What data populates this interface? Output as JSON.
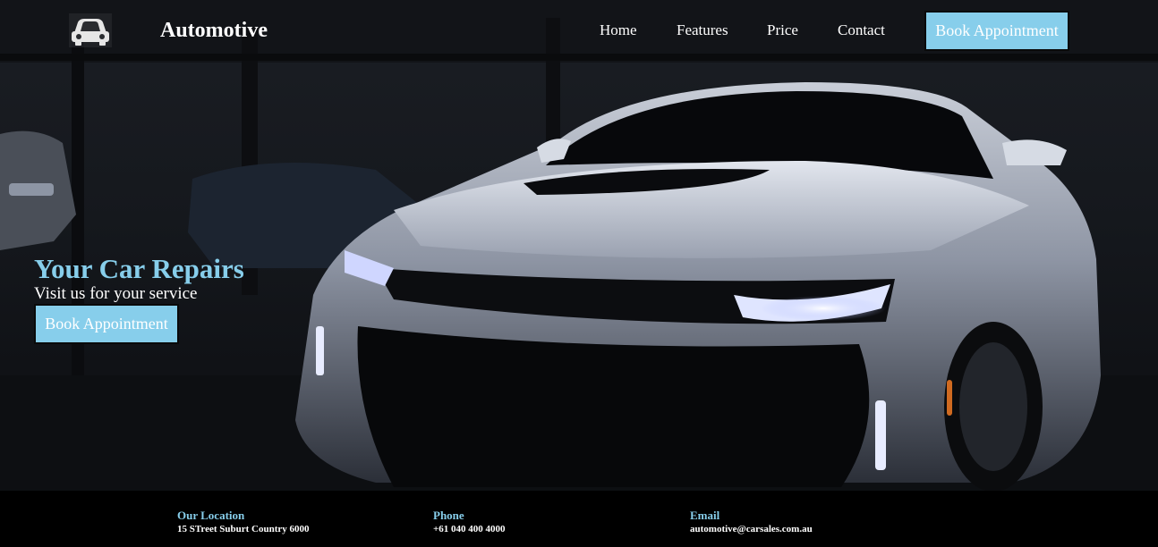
{
  "colors": {
    "accent": "#87ceeb",
    "text": "#ffffff",
    "background": "#000000"
  },
  "header": {
    "logo_icon": "car-icon",
    "brand": "Automotive",
    "nav": {
      "home": "Home",
      "features": "Features",
      "price": "Price",
      "contact": "Contact"
    },
    "cta_label": "Book Appointment"
  },
  "hero": {
    "title": "Your Car Repairs",
    "subtitle": "Visit us for your service",
    "cta_label": "Book Appointment"
  },
  "footer": {
    "location": {
      "label": "Our Location",
      "value": "15 STreet Suburt Country 6000"
    },
    "phone": {
      "label": "Phone",
      "value": "+61 040 400 4000"
    },
    "email": {
      "label": "Email",
      "value": "automotive@carsales.com.au"
    }
  }
}
